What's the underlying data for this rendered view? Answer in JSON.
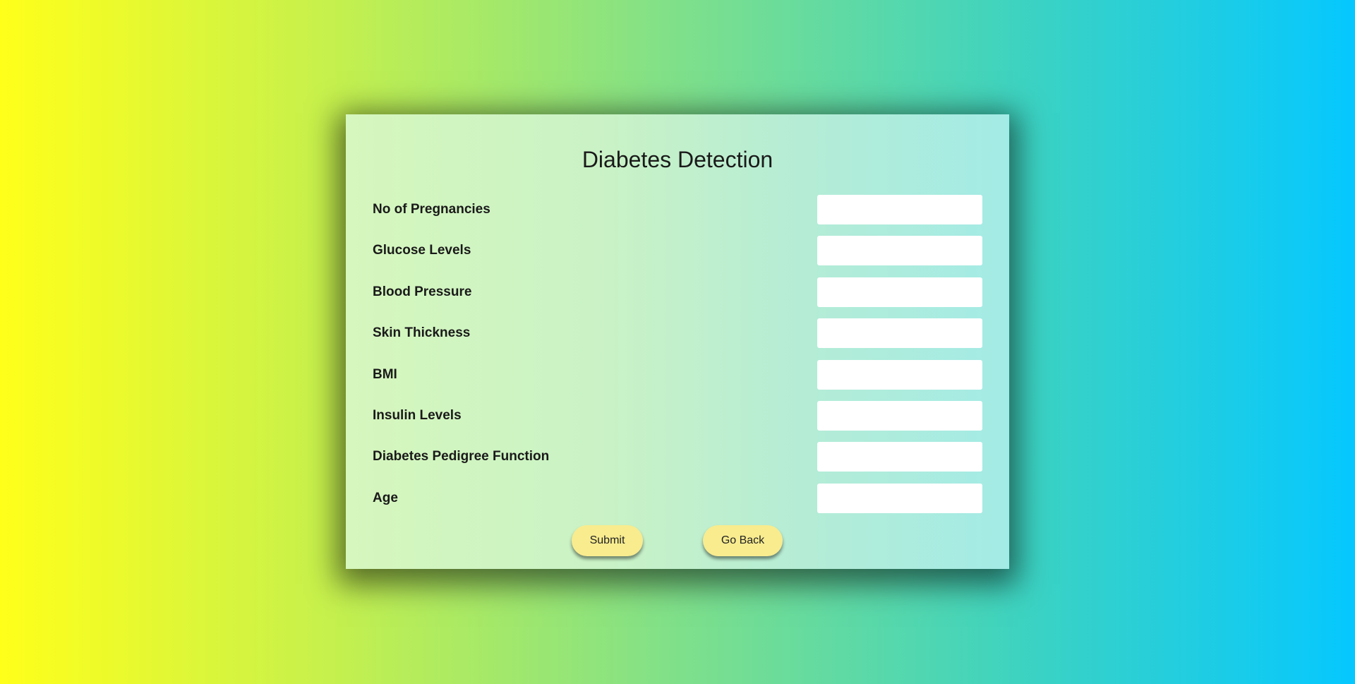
{
  "form": {
    "title": "Diabetes Detection",
    "fields": [
      {
        "label": "No of Pregnancies",
        "value": "",
        "placeholder": ""
      },
      {
        "label": "Glucose Levels",
        "value": "",
        "placeholder": ""
      },
      {
        "label": "Blood Pressure",
        "value": "",
        "placeholder": ""
      },
      {
        "label": "Skin Thickness",
        "value": "",
        "placeholder": ""
      },
      {
        "label": "BMI",
        "value": "",
        "placeholder": ""
      },
      {
        "label": "Insulin Levels",
        "value": "",
        "placeholder": ""
      },
      {
        "label": "Diabetes Pedigree Function",
        "value": "",
        "placeholder": ""
      },
      {
        "label": "Age",
        "value": "",
        "placeholder": ""
      }
    ],
    "submit_label": "Submit",
    "back_label": "Go Back"
  },
  "colors": {
    "background_left": "#ffff1a",
    "background_right": "#05c8ff",
    "button": "#f8ec8f",
    "input": "#ffffff",
    "text": "#1a1a1a"
  }
}
